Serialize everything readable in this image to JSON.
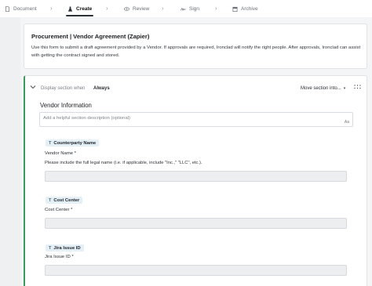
{
  "nav": {
    "steps": [
      {
        "label": "Document",
        "icon": "document-icon"
      },
      {
        "label": "Create",
        "icon": "flask-icon",
        "active": true
      },
      {
        "label": "Review",
        "icon": "eye-icon"
      },
      {
        "label": "Sign",
        "icon": "signature-icon"
      },
      {
        "label": "Archive",
        "icon": "archive-icon"
      }
    ]
  },
  "intro": {
    "title": "Procurement | Vendor Agreement (Zapier)",
    "description": "Use this form to submit a draft agreement provided by a Vendor. If approvals are required, Ironclad will notify the right people. After approvals, Ironclad can assist with getting the contract signed and stored."
  },
  "section": {
    "display_when_label": "Display section when",
    "display_when_value": "Always",
    "move_label": "Move section into...",
    "title": "Vendor Information",
    "description_placeholder": "Add a helpful section description (optional)",
    "format_hint": "Aa",
    "fields": [
      {
        "badge": "Counterparty Name",
        "label": "Vendor Name *",
        "help": "Please include the full legal name (i.e. if applicable, include \"Inc.,\" \"LLC\", etc.)."
      },
      {
        "badge": "Cost Center",
        "label": "Cost Center *",
        "help": ""
      },
      {
        "badge": "Jira Issue ID",
        "label": "Jira Issue ID *",
        "help": ""
      }
    ]
  },
  "colors": {
    "accent_green": "#3a9a5b",
    "badge_bg": "#e5eff6"
  }
}
